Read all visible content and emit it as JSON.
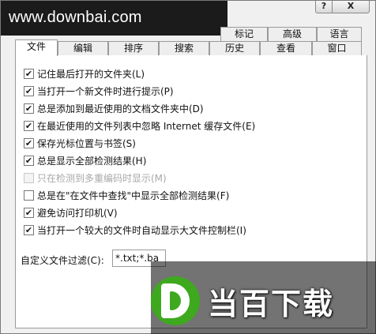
{
  "watermark": {
    "text": "www.downbai.com"
  },
  "title_buttons": {
    "help": "?",
    "close": "X"
  },
  "tabs_top": [
    {
      "label": "标记"
    },
    {
      "label": "高级"
    },
    {
      "label": "语言"
    }
  ],
  "tabs_bottom": [
    {
      "label": "文件"
    },
    {
      "label": "编辑"
    },
    {
      "label": "排序"
    },
    {
      "label": "搜索"
    },
    {
      "label": "历史"
    },
    {
      "label": "查看"
    },
    {
      "label": "窗口"
    }
  ],
  "options": [
    {
      "label": "记住最后打开的文件夹(L)",
      "checked": true,
      "enabled": true
    },
    {
      "label": "当打开一个新文件时进行提示(P)",
      "checked": true,
      "enabled": true
    },
    {
      "label": "总是添加到最近使用的文档文件夹中(D)",
      "checked": true,
      "enabled": true
    },
    {
      "label": "在最近使用的文件列表中忽略 Internet 缓存文件(E)",
      "checked": true,
      "enabled": true
    },
    {
      "label": "保存光标位置与书签(S)",
      "checked": true,
      "enabled": true
    },
    {
      "label": "总是显示全部检测结果(H)",
      "checked": true,
      "enabled": true
    },
    {
      "label": "只在检测到多重编码时显示(M)",
      "checked": false,
      "enabled": false
    },
    {
      "label": "总是在\"在文件中查找\"中显示全部检测结果(F)",
      "checked": false,
      "enabled": true
    },
    {
      "label": "避免访问打印机(V)",
      "checked": true,
      "enabled": true
    },
    {
      "label": "当打开一个较大的文件时自动显示大文件控制栏(I)",
      "checked": true,
      "enabled": true
    }
  ],
  "filter": {
    "label": "自定义文件过滤(C):",
    "value": "*.txt;*.ba"
  },
  "logo": {
    "text": "当百下载"
  },
  "colors": {
    "logo_green": "#3ea91f",
    "watermark_bg": "#1b1b1b"
  }
}
